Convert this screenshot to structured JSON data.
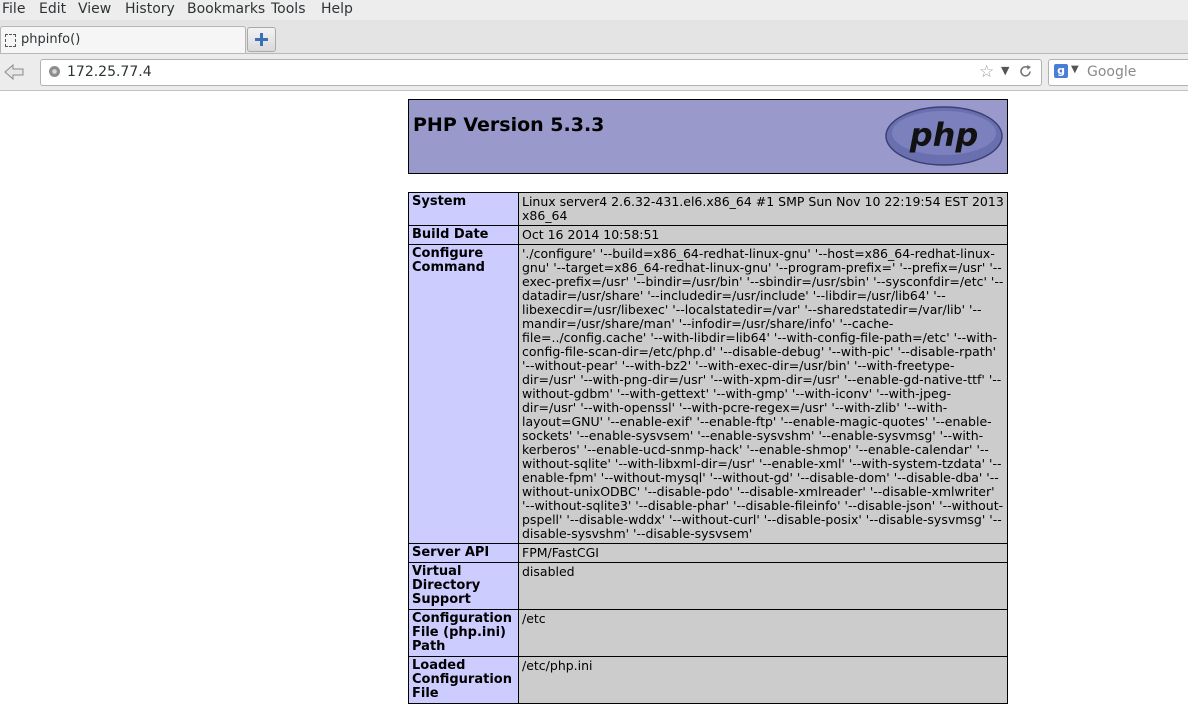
{
  "menu": [
    "File",
    "Edit",
    "View",
    "History",
    "Bookmarks",
    "Tools",
    "Help"
  ],
  "tab": {
    "title": "phpinfo()"
  },
  "nav": {
    "url": "172.25.77.4",
    "search_placeholder": "Google"
  },
  "page": {
    "title": "PHP Version 5.3.3",
    "logo_text": "php",
    "rows": [
      {
        "key": "System",
        "value": "Linux server4 2.6.32-431.el6.x86_64 #1 SMP Sun Nov 10 22:19:54 EST 2013 x86_64"
      },
      {
        "key": "Build Date",
        "value": "Oct 16 2014 10:58:51"
      },
      {
        "key": "Configure Command",
        "value": "'./configure' '--build=x86_64-redhat-linux-gnu' '--host=x86_64-redhat-linux-gnu' '--target=x86_64-redhat-linux-gnu' '--program-prefix=' '--prefix=/usr' '--exec-prefix=/usr' '--bindir=/usr/bin' '--sbindir=/usr/sbin' '--sysconfdir=/etc' '--datadir=/usr/share' '--includedir=/usr/include' '--libdir=/usr/lib64' '--libexecdir=/usr/libexec' '--localstatedir=/var' '--sharedstatedir=/var/lib' '--mandir=/usr/share/man' '--infodir=/usr/share/info' '--cache-file=../config.cache' '--with-libdir=lib64' '--with-config-file-path=/etc' '--with-config-file-scan-dir=/etc/php.d' '--disable-debug' '--with-pic' '--disable-rpath' '--without-pear' '--with-bz2' '--with-exec-dir=/usr/bin' '--with-freetype-dir=/usr' '--with-png-dir=/usr' '--with-xpm-dir=/usr' '--enable-gd-native-ttf' '--without-gdbm' '--with-gettext' '--with-gmp' '--with-iconv' '--with-jpeg-dir=/usr' '--with-openssl' '--with-pcre-regex=/usr' '--with-zlib' '--with-layout=GNU' '--enable-exif' '--enable-ftp' '--enable-magic-quotes' '--enable-sockets' '--enable-sysvsem' '--enable-sysvshm' '--enable-sysvmsg' '--with-kerberos' '--enable-ucd-snmp-hack' '--enable-shmop' '--enable-calendar' '--without-sqlite' '--with-libxml-dir=/usr' '--enable-xml' '--with-system-tzdata' '--enable-fpm' '--without-mysql' '--without-gd' '--disable-dom' '--disable-dba' '--without-unixODBC' '--disable-pdo' '--disable-xmlreader' '--disable-xmlwriter' '--without-sqlite3' '--disable-phar' '--disable-fileinfo' '--disable-json' '--without-pspell' '--disable-wddx' '--without-curl' '--disable-posix' '--disable-sysvmsg' '--disable-sysvshm' '--disable-sysvsem'"
      },
      {
        "key": "Server API",
        "value": "FPM/FastCGI"
      },
      {
        "key": "Virtual Directory Support",
        "value": "disabled"
      },
      {
        "key": "Configuration File (php.ini) Path",
        "value": "/etc"
      },
      {
        "key": "Loaded Configuration File",
        "value": "/etc/php.ini"
      }
    ]
  }
}
